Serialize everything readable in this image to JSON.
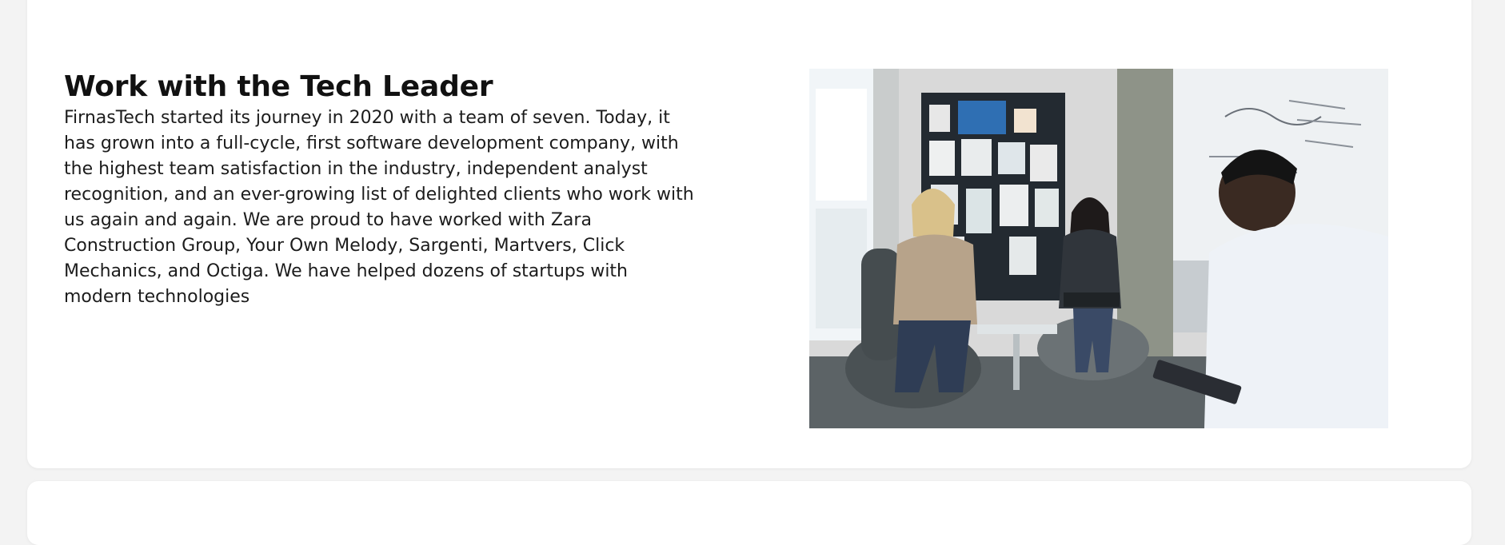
{
  "section": {
    "heading": "Work with the Tech Leader",
    "body": "FirnasTech started its journey in 2020 with a team of seven. Today, it has grown into a full-cycle, first software development company, with the highest team satisfaction in the industry, independent analyst recognition, and an ever-growing list of delighted clients who work with us again and again. We are proud to have worked with Zara Construction Group, Your Own Melody, Sargenti, Martvers, Click Mechanics, and Octiga. We have helped dozens of startups with modern technologies"
  },
  "photo": {
    "icon": "team-meeting-photo",
    "colors": {
      "wall": "#dcdcdc",
      "window": "#eef3f6",
      "board": "#2a2f36",
      "pillar": "#8f9488",
      "chair": "#4b5255",
      "shirt": "#eef2f7",
      "sweater": "#b8a58c",
      "skin_dark": "#3b2a22",
      "skin_light": "#e8c6a8"
    }
  }
}
